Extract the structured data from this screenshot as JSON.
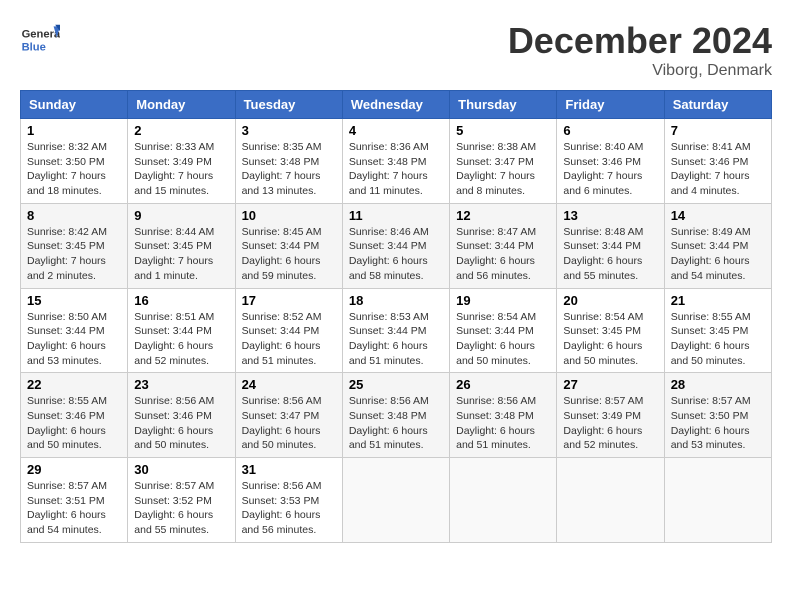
{
  "header": {
    "logo_line1": "General",
    "logo_line2": "Blue",
    "month_title": "December 2024",
    "location": "Viborg, Denmark"
  },
  "weekdays": [
    "Sunday",
    "Monday",
    "Tuesday",
    "Wednesday",
    "Thursday",
    "Friday",
    "Saturday"
  ],
  "weeks": [
    [
      {
        "day": "1",
        "details": "Sunrise: 8:32 AM\nSunset: 3:50 PM\nDaylight: 7 hours\nand 18 minutes."
      },
      {
        "day": "2",
        "details": "Sunrise: 8:33 AM\nSunset: 3:49 PM\nDaylight: 7 hours\nand 15 minutes."
      },
      {
        "day": "3",
        "details": "Sunrise: 8:35 AM\nSunset: 3:48 PM\nDaylight: 7 hours\nand 13 minutes."
      },
      {
        "day": "4",
        "details": "Sunrise: 8:36 AM\nSunset: 3:48 PM\nDaylight: 7 hours\nand 11 minutes."
      },
      {
        "day": "5",
        "details": "Sunrise: 8:38 AM\nSunset: 3:47 PM\nDaylight: 7 hours\nand 8 minutes."
      },
      {
        "day": "6",
        "details": "Sunrise: 8:40 AM\nSunset: 3:46 PM\nDaylight: 7 hours\nand 6 minutes."
      },
      {
        "day": "7",
        "details": "Sunrise: 8:41 AM\nSunset: 3:46 PM\nDaylight: 7 hours\nand 4 minutes."
      }
    ],
    [
      {
        "day": "8",
        "details": "Sunrise: 8:42 AM\nSunset: 3:45 PM\nDaylight: 7 hours\nand 2 minutes."
      },
      {
        "day": "9",
        "details": "Sunrise: 8:44 AM\nSunset: 3:45 PM\nDaylight: 7 hours\nand 1 minute."
      },
      {
        "day": "10",
        "details": "Sunrise: 8:45 AM\nSunset: 3:44 PM\nDaylight: 6 hours\nand 59 minutes."
      },
      {
        "day": "11",
        "details": "Sunrise: 8:46 AM\nSunset: 3:44 PM\nDaylight: 6 hours\nand 58 minutes."
      },
      {
        "day": "12",
        "details": "Sunrise: 8:47 AM\nSunset: 3:44 PM\nDaylight: 6 hours\nand 56 minutes."
      },
      {
        "day": "13",
        "details": "Sunrise: 8:48 AM\nSunset: 3:44 PM\nDaylight: 6 hours\nand 55 minutes."
      },
      {
        "day": "14",
        "details": "Sunrise: 8:49 AM\nSunset: 3:44 PM\nDaylight: 6 hours\nand 54 minutes."
      }
    ],
    [
      {
        "day": "15",
        "details": "Sunrise: 8:50 AM\nSunset: 3:44 PM\nDaylight: 6 hours\nand 53 minutes."
      },
      {
        "day": "16",
        "details": "Sunrise: 8:51 AM\nSunset: 3:44 PM\nDaylight: 6 hours\nand 52 minutes."
      },
      {
        "day": "17",
        "details": "Sunrise: 8:52 AM\nSunset: 3:44 PM\nDaylight: 6 hours\nand 51 minutes."
      },
      {
        "day": "18",
        "details": "Sunrise: 8:53 AM\nSunset: 3:44 PM\nDaylight: 6 hours\nand 51 minutes."
      },
      {
        "day": "19",
        "details": "Sunrise: 8:54 AM\nSunset: 3:44 PM\nDaylight: 6 hours\nand 50 minutes."
      },
      {
        "day": "20",
        "details": "Sunrise: 8:54 AM\nSunset: 3:45 PM\nDaylight: 6 hours\nand 50 minutes."
      },
      {
        "day": "21",
        "details": "Sunrise: 8:55 AM\nSunset: 3:45 PM\nDaylight: 6 hours\nand 50 minutes."
      }
    ],
    [
      {
        "day": "22",
        "details": "Sunrise: 8:55 AM\nSunset: 3:46 PM\nDaylight: 6 hours\nand 50 minutes."
      },
      {
        "day": "23",
        "details": "Sunrise: 8:56 AM\nSunset: 3:46 PM\nDaylight: 6 hours\nand 50 minutes."
      },
      {
        "day": "24",
        "details": "Sunrise: 8:56 AM\nSunset: 3:47 PM\nDaylight: 6 hours\nand 50 minutes."
      },
      {
        "day": "25",
        "details": "Sunrise: 8:56 AM\nSunset: 3:48 PM\nDaylight: 6 hours\nand 51 minutes."
      },
      {
        "day": "26",
        "details": "Sunrise: 8:56 AM\nSunset: 3:48 PM\nDaylight: 6 hours\nand 51 minutes."
      },
      {
        "day": "27",
        "details": "Sunrise: 8:57 AM\nSunset: 3:49 PM\nDaylight: 6 hours\nand 52 minutes."
      },
      {
        "day": "28",
        "details": "Sunrise: 8:57 AM\nSunset: 3:50 PM\nDaylight: 6 hours\nand 53 minutes."
      }
    ],
    [
      {
        "day": "29",
        "details": "Sunrise: 8:57 AM\nSunset: 3:51 PM\nDaylight: 6 hours\nand 54 minutes."
      },
      {
        "day": "30",
        "details": "Sunrise: 8:57 AM\nSunset: 3:52 PM\nDaylight: 6 hours\nand 55 minutes."
      },
      {
        "day": "31",
        "details": "Sunrise: 8:56 AM\nSunset: 3:53 PM\nDaylight: 6 hours\nand 56 minutes."
      },
      {
        "day": "",
        "details": ""
      },
      {
        "day": "",
        "details": ""
      },
      {
        "day": "",
        "details": ""
      },
      {
        "day": "",
        "details": ""
      }
    ]
  ]
}
